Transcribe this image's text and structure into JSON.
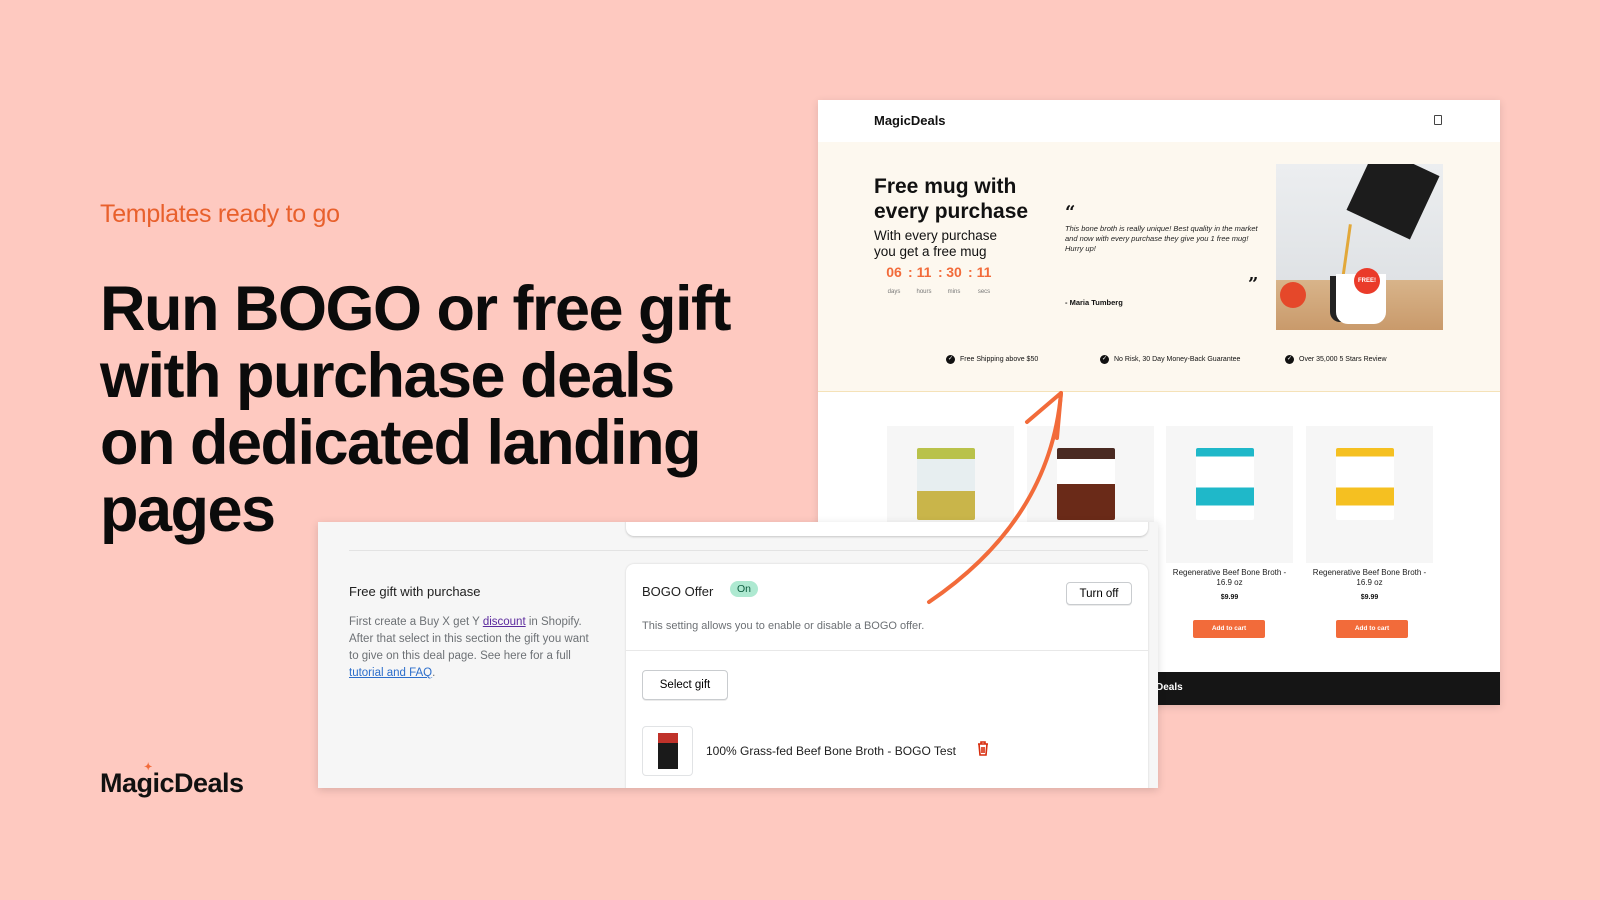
{
  "left": {
    "tagline": "Templates ready to go",
    "headline": "Run BOGO or free gift with purchase deals on dedicated landing pages",
    "brand": "MagicDeals"
  },
  "colors": {
    "background": "#fec9c0",
    "accent": "#f26b3a",
    "tagline": "#e8602c"
  },
  "landing": {
    "logo": "MagicDeals",
    "cart_icon": "shopping-bag-icon",
    "hero": {
      "title": "Free mug with every purchase",
      "subtitle": "With every purchase you get a free mug",
      "countdown": [
        {
          "value": "06",
          "unit": "days"
        },
        {
          "value": "11",
          "unit": "hours"
        },
        {
          "value": "30",
          "unit": "mins"
        },
        {
          "value": "11",
          "unit": "secs"
        }
      ],
      "quote": "This bone broth is really unique! Best quality in the market and now with every purchase they give you 1 free mug! Hurry up!",
      "author": "- Maria Tumberg",
      "badge": "FREE!"
    },
    "perks": [
      "Free Shipping above $50",
      "No Risk, 30 Day Money-Back Guarantee",
      "Over 35,000 5 Stars Review"
    ],
    "products": [
      {
        "name": "Regenerative Beef Bone Broth - 16.9 oz",
        "price": "$9.99",
        "button": "Add to cart"
      },
      {
        "name": "Regenerative Beef Bone Broth - 16.9 oz",
        "price": "$9.99",
        "button": "Add to cart"
      }
    ],
    "footer_text": "Deals"
  },
  "admin": {
    "section_title": "Free gift with purchase",
    "desc_1": "First create a Buy X get Y ",
    "desc_link_1": "discount",
    "desc_2": " in Shopify. After that select in this section the gift you want to give on this deal page. See here for a full ",
    "desc_link_2": "tutorial and FAQ",
    "desc_3": ".",
    "card_title": "BOGO Offer",
    "status_badge": "On",
    "turn_off_label": "Turn off",
    "card_desc": "This setting allows you to enable or disable a BOGO offer.",
    "select_gift_label": "Select gift",
    "gift_name": "100% Grass-fed Beef Bone Broth - BOGO Test"
  }
}
